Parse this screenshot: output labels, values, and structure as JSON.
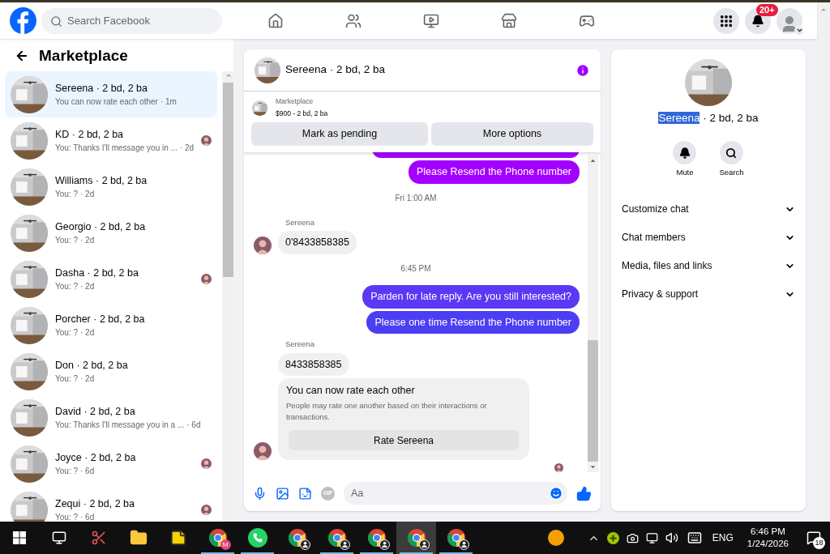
{
  "header": {
    "search": {
      "placeholder": "Search Facebook"
    },
    "nav": [
      {
        "kind": "home",
        "selected": false
      },
      {
        "kind": "friends",
        "selected": false
      },
      {
        "kind": "video",
        "selected": false
      },
      {
        "kind": "marketplace",
        "selected": false
      },
      {
        "kind": "gaming",
        "selected": false
      }
    ],
    "notification_badge": "20+"
  },
  "sidebar": {
    "title": "Marketplace",
    "items": [
      {
        "name": "Sereena · 2 bd, 2 ba",
        "preview": "You can now rate each other",
        "time": "· 1m",
        "selected": true,
        "seen": false
      },
      {
        "name": "KD · 2 bd, 2 ba",
        "preview": "You: Thanks I'll message you in ...",
        "time": "· 2d",
        "selected": false,
        "seen": true
      },
      {
        "name": "Williams · 2 bd, 2 ba",
        "preview": "You: ?",
        "time": "· 2d",
        "selected": false,
        "seen": false
      },
      {
        "name": "Georgio · 2 bd, 2 ba",
        "preview": "You: ?",
        "time": "· 2d",
        "selected": false,
        "seen": false
      },
      {
        "name": "Dasha · 2 bd, 2 ba",
        "preview": "You: ?",
        "time": "· 2d",
        "selected": false,
        "seen": true
      },
      {
        "name": "Porcher · 2 bd, 2 ba",
        "preview": "You: ?",
        "time": "· 2d",
        "selected": false,
        "seen": false
      },
      {
        "name": "Don · 2 bd, 2 ba",
        "preview": "You: ?",
        "time": "· 2d",
        "selected": false,
        "seen": false
      },
      {
        "name": "David · 2 bd, 2 ba",
        "preview": "You: Thanks I'll message you in a ...",
        "time": "· 6d",
        "selected": false,
        "seen": false
      },
      {
        "name": "Joyce · 2 bd, 2 ba",
        "preview": "You: ?",
        "time": "· 6d",
        "selected": false,
        "seen": true
      },
      {
        "name": "Zequi · 2 bd, 2 ba",
        "preview": "You: ?",
        "time": "· 6d",
        "selected": false,
        "seen": true
      }
    ]
  },
  "chat": {
    "title": "Sereena · 2 bd, 2 ba",
    "listing": {
      "label": "Marketplace",
      "detail": "$900 - 2 bd, 2 ba"
    },
    "buttons": [
      "Mark as pending",
      "More options"
    ],
    "messages": [
      {
        "kind": "partial",
        "color": "#a200ff"
      },
      {
        "kind": "outgoing",
        "text": "Please Resend the Phone number",
        "color": "#a200ff"
      },
      {
        "kind": "time",
        "text": "Fri 1:00 AM"
      },
      {
        "kind": "incoming",
        "sender": "Sereena",
        "text": "0'8433858385",
        "avatar": true
      },
      {
        "kind": "time",
        "text": "6:45 PM"
      },
      {
        "kind": "outgoing",
        "text": "Parden for late reply. Are you still interested?",
        "color": "#5c37f5"
      },
      {
        "kind": "outgoing",
        "text": "Please one time Resend the Phone number",
        "color": "#4b3ff3"
      },
      {
        "kind": "incoming",
        "sender": "Sereena",
        "text": "8433858385",
        "avatar": false
      },
      {
        "kind": "rating",
        "title": "You can now rate each other",
        "text": "People may rate one another based on their interactions or transactions.",
        "button": "Rate Sereena",
        "avatar": true
      },
      {
        "kind": "seen"
      }
    ],
    "composer": {
      "gif_label": "GIF",
      "placeholder": "Aa"
    }
  },
  "details": {
    "title_selection": "Sereena",
    "title_rest": " · 2 bd, 2 ba",
    "actions": [
      {
        "kind": "mute",
        "label": "Mute"
      },
      {
        "kind": "search",
        "label": "Search"
      }
    ],
    "sections": [
      {
        "label": "Customize chat",
        "expanded": false
      },
      {
        "label": "Chat members",
        "expanded": false
      },
      {
        "label": "Media, files and links",
        "expanded": false
      },
      {
        "label": "Privacy & support",
        "expanded": false
      }
    ]
  },
  "taskbar": {
    "apps": [
      {
        "kind": "taskview",
        "open": false,
        "active": false
      },
      {
        "kind": "snip",
        "open": false,
        "active": false
      },
      {
        "kind": "folder",
        "open": false,
        "active": false
      },
      {
        "kind": "notes",
        "open": false,
        "active": false
      },
      {
        "kind": "chrome",
        "badge": "M",
        "open": true,
        "active": false
      },
      {
        "kind": "whatsapp",
        "open": true,
        "active": false
      },
      {
        "kind": "chrome",
        "open": false,
        "active": false
      },
      {
        "kind": "chrome",
        "open": true,
        "active": false
      },
      {
        "kind": "chrome",
        "open": true,
        "active": false
      },
      {
        "kind": "chrome",
        "open": true,
        "active": true
      },
      {
        "kind": "chrome",
        "open": true,
        "active": false
      }
    ],
    "language": "ENG",
    "time": "6:46 PM",
    "date": "1/24/2026",
    "notifications": "18"
  }
}
